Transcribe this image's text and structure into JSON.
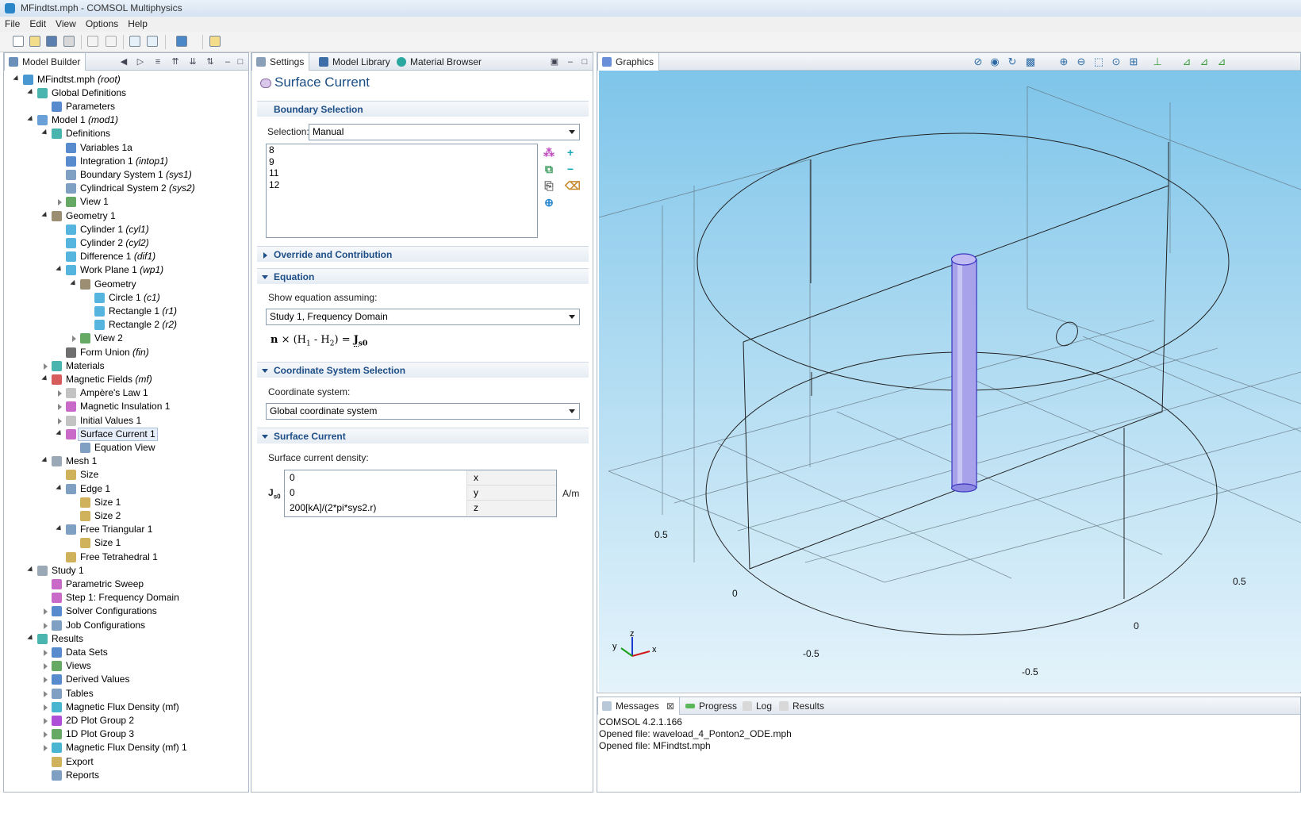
{
  "window": {
    "title": "MFindtst.mph - COMSOL Multiphysics"
  },
  "menu": [
    "File",
    "Edit",
    "View",
    "Options",
    "Help"
  ],
  "model_builder": {
    "tab_label": "Model Builder",
    "tree": [
      {
        "label": "MFindtst.mph",
        "tag": "(root)",
        "icon": "root-icon",
        "color": "#2a86c9"
      },
      {
        "label": "Global Definitions",
        "tag": "",
        "icon": "global-definitions-icon",
        "color": "#2aa8a0"
      },
      {
        "label": "Parameters",
        "tag": "",
        "icon": "parameters-icon",
        "color": "#3b77c6"
      },
      {
        "label": "Model 1",
        "tag": "(mod1)",
        "icon": "model-icon",
        "color": "#4f8fd1"
      },
      {
        "label": "Definitions",
        "tag": "",
        "icon": "definitions-icon",
        "color": "#2aa8a0"
      },
      {
        "label": "Variables 1a",
        "tag": "",
        "icon": "variables-icon",
        "color": "#3b77c6"
      },
      {
        "label": "Integration 1",
        "tag": "(intop1)",
        "icon": "integration-icon",
        "color": "#3b77c6"
      },
      {
        "label": "Boundary System 1",
        "tag": "(sys1)",
        "icon": "coordinate-system-icon",
        "color": "#6a8fb8"
      },
      {
        "label": "Cylindrical System 2",
        "tag": "(sys2)",
        "icon": "coordinate-system-icon",
        "color": "#6a8fb8"
      },
      {
        "label": "View 1",
        "tag": "",
        "icon": "view-icon",
        "color": "#4a9a4a"
      },
      {
        "label": "Geometry 1",
        "tag": "",
        "icon": "geometry-icon",
        "color": "#8a7a5a"
      },
      {
        "label": "Cylinder 1",
        "tag": "(cyl1)",
        "icon": "cylinder-icon",
        "color": "#38a8d8"
      },
      {
        "label": "Cylinder 2",
        "tag": "(cyl2)",
        "icon": "cylinder-icon",
        "color": "#38a8d8"
      },
      {
        "label": "Difference 1",
        "tag": "(dif1)",
        "icon": "difference-icon",
        "color": "#38a8d8"
      },
      {
        "label": "Work Plane 1",
        "tag": "(wp1)",
        "icon": "work-plane-icon",
        "color": "#38a8d8"
      },
      {
        "label": "Geometry",
        "tag": "",
        "icon": "geometry-icon",
        "color": "#8a7a5a"
      },
      {
        "label": "Circle 1",
        "tag": "(c1)",
        "icon": "circle-icon",
        "color": "#38a8d8"
      },
      {
        "label": "Rectangle 1",
        "tag": "(r1)",
        "icon": "rectangle-icon",
        "color": "#38a8d8"
      },
      {
        "label": "Rectangle 2",
        "tag": "(r2)",
        "icon": "rectangle-icon",
        "color": "#38a8d8"
      },
      {
        "label": "View 2",
        "tag": "",
        "icon": "view-icon",
        "color": "#4a9a4a"
      },
      {
        "label": "Form Union",
        "tag": "(fin)",
        "icon": "form-union-icon",
        "color": "#555555"
      },
      {
        "label": "Materials",
        "tag": "",
        "icon": "materials-icon",
        "color": "#2aa8a0"
      },
      {
        "label": "Magnetic Fields",
        "tag": "(mf)",
        "icon": "magnetic-fields-icon",
        "color": "#d04040"
      },
      {
        "label": "Ampère's Law 1",
        "tag": "",
        "icon": "amperes-law-icon",
        "color": "#b8b8b8"
      },
      {
        "label": "Magnetic Insulation 1",
        "tag": "",
        "icon": "magnetic-insulation-icon",
        "color": "#c050c0"
      },
      {
        "label": "Initial Values 1",
        "tag": "",
        "icon": "initial-values-icon",
        "color": "#b8b8b8"
      },
      {
        "label": "Surface Current 1",
        "tag": "",
        "icon": "surface-current-icon",
        "color": "#c050c0"
      },
      {
        "label": "Equation View",
        "tag": "",
        "icon": "equation-view-icon",
        "color": "#6a8fb8"
      },
      {
        "label": "Mesh 1",
        "tag": "",
        "icon": "mesh-icon",
        "color": "#8a9aaa"
      },
      {
        "label": "Size",
        "tag": "",
        "icon": "size-icon",
        "color": "#c9a440"
      },
      {
        "label": "Edge 1",
        "tag": "",
        "icon": "edge-icon",
        "color": "#6a8fb8"
      },
      {
        "label": "Size 1",
        "tag": "",
        "icon": "size-icon",
        "color": "#c9a440"
      },
      {
        "label": "Size 2",
        "tag": "",
        "icon": "size-icon",
        "color": "#c9a440"
      },
      {
        "label": "Free Triangular 1",
        "tag": "",
        "icon": "free-triangular-icon",
        "color": "#6a8fb8"
      },
      {
        "label": "Size 1",
        "tag": "",
        "icon": "size-icon",
        "color": "#c9a440"
      },
      {
        "label": "Free Tetrahedral 1",
        "tag": "",
        "icon": "free-tetrahedral-icon",
        "color": "#c9a440"
      },
      {
        "label": "Study 1",
        "tag": "",
        "icon": "study-icon",
        "color": "#8a9aaa"
      },
      {
        "label": "Parametric Sweep",
        "tag": "",
        "icon": "parametric-sweep-icon",
        "color": "#c050c0"
      },
      {
        "label": "Step 1: Frequency Domain",
        "tag": "",
        "icon": "frequency-domain-icon",
        "color": "#c050c0"
      },
      {
        "label": "Solver Configurations",
        "tag": "",
        "icon": "solver-configurations-icon",
        "color": "#3b77c6"
      },
      {
        "label": "Job Configurations",
        "tag": "",
        "icon": "job-configurations-icon",
        "color": "#6a8fb8"
      },
      {
        "label": "Results",
        "tag": "",
        "icon": "results-icon",
        "color": "#2aa8a0"
      },
      {
        "label": "Data Sets",
        "tag": "",
        "icon": "data-sets-icon",
        "color": "#3b77c6"
      },
      {
        "label": "Views",
        "tag": "",
        "icon": "views-icon",
        "color": "#4a9a4a"
      },
      {
        "label": "Derived Values",
        "tag": "",
        "icon": "derived-values-icon",
        "color": "#3b77c6"
      },
      {
        "label": "Tables",
        "tag": "",
        "icon": "tables-icon",
        "color": "#6a8fb8"
      },
      {
        "label": "Magnetic Flux Density (mf)",
        "tag": "",
        "icon": "plot-3d-icon",
        "color": "#2aa8c8"
      },
      {
        "label": "2D Plot Group 2",
        "tag": "",
        "icon": "plot-2d-icon",
        "color": "#a030d0"
      },
      {
        "label": "1D Plot Group 3",
        "tag": "",
        "icon": "plot-1d-icon",
        "color": "#4a9a4a"
      },
      {
        "label": "Magnetic Flux Density (mf) 1",
        "tag": "",
        "icon": "plot-3d-icon",
        "color": "#2aa8c8"
      },
      {
        "label": "Export",
        "tag": "",
        "icon": "export-icon",
        "color": "#c9a440"
      },
      {
        "label": "Reports",
        "tag": "",
        "icon": "reports-icon",
        "color": "#6a8fb8"
      }
    ]
  },
  "settings": {
    "tabs": [
      "Settings",
      "Model Library",
      "Material Browser"
    ],
    "title": "Surface Current",
    "boundary_selection": {
      "header": "Boundary Selection",
      "selection_label": "Selection:",
      "selection_value": "Manual",
      "items": [
        "8",
        "9",
        "11",
        "12"
      ]
    },
    "override_header": "Override and Contribution",
    "equation": {
      "header": "Equation",
      "show_label": "Show equation assuming:",
      "study_value": "Study 1, Frequency Domain",
      "formula_n": "n",
      "formula_mid": " × (H",
      "formula_sub1": "1",
      "formula_mid2": " - H",
      "formula_sub2": "2",
      "formula_end": ") = ",
      "formula_J": "J",
      "formula_Jsub": "s0"
    },
    "coordinate_system": {
      "header": "Coordinate System Selection",
      "label": "Coordinate system:",
      "value": "Global coordinate system"
    },
    "surface_current": {
      "header": "Surface Current",
      "label": "Surface current density:",
      "symbol": "J",
      "symbol_sub": "s0",
      "rows": [
        {
          "value": "0",
          "component": "x"
        },
        {
          "value": "0",
          "component": "y"
        },
        {
          "value": "200[kA]/(2*pi*sys2.r)",
          "component": "z"
        }
      ],
      "unit": "A/m"
    }
  },
  "graphics": {
    "tab_label": "Graphics",
    "axis_labels": {
      "a": "0.5",
      "b": "0",
      "c": "-0.5",
      "d": "0",
      "e": "-0.5",
      "f": "0.5"
    },
    "triad": {
      "x": "x",
      "y": "y",
      "z": "z"
    }
  },
  "messages": {
    "tabs": [
      "Messages",
      "Progress",
      "Log",
      "Results"
    ],
    "lines": [
      "COMSOL 4.2.1.166",
      "Opened file: waveload_4_Ponton2_ODE.mph",
      "Opened file: MFindtst.mph"
    ]
  }
}
